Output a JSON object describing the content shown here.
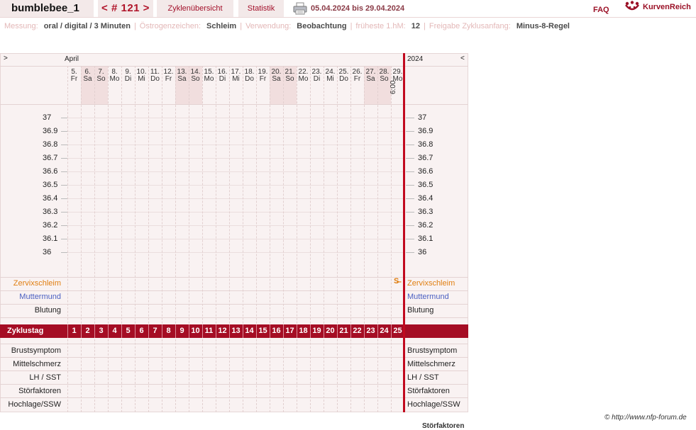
{
  "header": {
    "user": "bumblebee_1",
    "cycle": "< # 121 >",
    "overview": "Zyklenübersicht",
    "statistics": "Statistik",
    "daterange": "05.04.2024 bis 29.04.2024",
    "faq": "FAQ",
    "brand": "KurvenReich",
    "brand_color": "#9b1127"
  },
  "info": {
    "measure_label": "Messung:",
    "measure_value": "oral / digital / 3 Minuten",
    "estrogen_label": "Östrogenzeichen:",
    "estrogen_value": "Schleim",
    "usage_label": "Verwendung:",
    "usage_value": "Beobachtung",
    "hm_label": "früheste 1.hM:",
    "hm_value": "12",
    "release_label": "Freigabe Zyklusanfang:",
    "release_value": "Minus-8-Regel"
  },
  "chart": {
    "nav_prev": ">",
    "nav_next": "<",
    "month": "April",
    "year": "2024",
    "time": "6:00",
    "cervix_marker": "S̶",
    "days": [
      {
        "num": "5.",
        "wd": "Fr",
        "we": false
      },
      {
        "num": "6.",
        "wd": "Sa",
        "we": true
      },
      {
        "num": "7.",
        "wd": "So",
        "we": true
      },
      {
        "num": "8.",
        "wd": "Mo",
        "we": false
      },
      {
        "num": "9.",
        "wd": "Di",
        "we": false
      },
      {
        "num": "10.",
        "wd": "Mi",
        "we": false
      },
      {
        "num": "11.",
        "wd": "Do",
        "we": false
      },
      {
        "num": "12.",
        "wd": "Fr",
        "we": false
      },
      {
        "num": "13.",
        "wd": "Sa",
        "we": true
      },
      {
        "num": "14.",
        "wd": "So",
        "we": true
      },
      {
        "num": "15.",
        "wd": "Mo",
        "we": false
      },
      {
        "num": "16.",
        "wd": "Di",
        "we": false
      },
      {
        "num": "17.",
        "wd": "Mi",
        "we": false
      },
      {
        "num": "18.",
        "wd": "Do",
        "we": false
      },
      {
        "num": "19.",
        "wd": "Fr",
        "we": false
      },
      {
        "num": "20.",
        "wd": "Sa",
        "we": true
      },
      {
        "num": "21.",
        "wd": "So",
        "we": true
      },
      {
        "num": "22.",
        "wd": "Mo",
        "we": false
      },
      {
        "num": "23.",
        "wd": "Di",
        "we": false
      },
      {
        "num": "24.",
        "wd": "Mi",
        "we": false
      },
      {
        "num": "25.",
        "wd": "Do",
        "we": false
      },
      {
        "num": "26.",
        "wd": "Fr",
        "we": false
      },
      {
        "num": "27.",
        "wd": "Sa",
        "we": true
      },
      {
        "num": "28.",
        "wd": "So",
        "we": true
      },
      {
        "num": "29.",
        "wd": "Mo",
        "we": false
      }
    ],
    "temps": [
      "37",
      "36.9",
      "36.8",
      "36.7",
      "36.6",
      "36.5",
      "36.4",
      "36.3",
      "36.2",
      "36.1",
      "36"
    ],
    "rows_top": [
      {
        "label": "Zervixschleim",
        "color": "#e07f12"
      },
      {
        "label": "Muttermund",
        "color": "#4a5fc1"
      },
      {
        "label": "Blutung",
        "color": "#222222"
      }
    ],
    "cycle_label": "Zyklustag",
    "cycle_days": [
      "1",
      "2",
      "3",
      "4",
      "5",
      "6",
      "7",
      "8",
      "9",
      "10",
      "11",
      "12",
      "13",
      "14",
      "15",
      "16",
      "17",
      "18",
      "19",
      "20",
      "21",
      "22",
      "23",
      "24",
      "25"
    ],
    "rows_bottom": [
      "Brustsymptom",
      "Mittelschmerz",
      "LH / SST",
      "Störfaktoren",
      "Hochlage/SSW"
    ]
  },
  "footer": {
    "copyright": "© http://www.nfp-forum.de",
    "bottom_note": "Störfaktoren"
  }
}
